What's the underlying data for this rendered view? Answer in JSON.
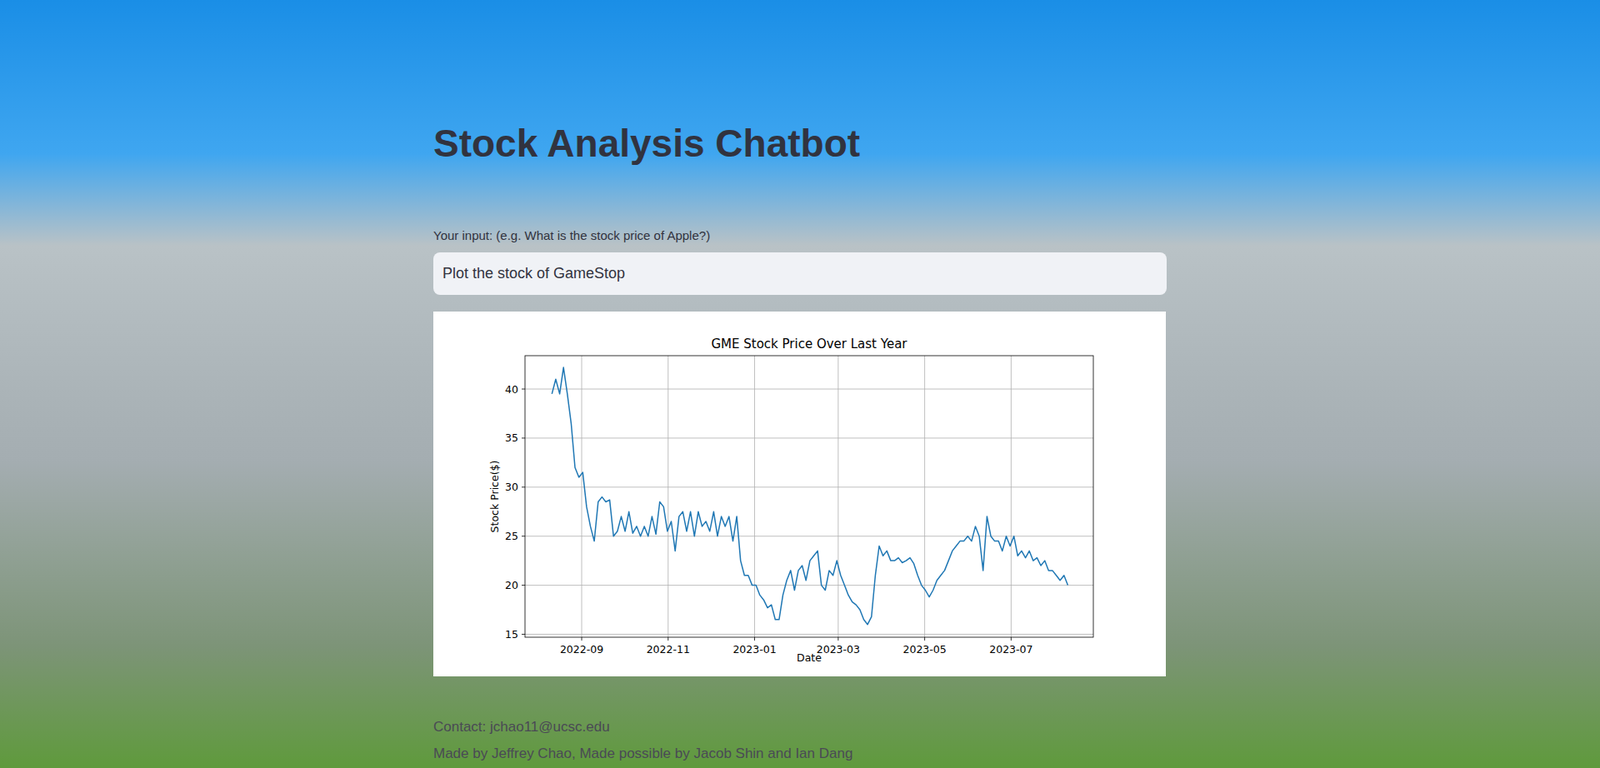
{
  "title": "Stock Analysis Chatbot",
  "input": {
    "label": "Your input: (e.g. What is the stock price of Apple?)",
    "value": "Plot the stock of GameStop"
  },
  "chart": {
    "title": "GME Stock Price Over Last Year",
    "y_label": "Stock Price($)",
    "x_label": "Date",
    "y_ticks": [
      "15",
      "20",
      "25",
      "30",
      "35",
      "40"
    ],
    "x_ticks": [
      "2022-09",
      "2022-11",
      "2023-01",
      "2023-03",
      "2023-05",
      "2023-07"
    ],
    "series": [
      {
        "values": [
          39.5,
          41,
          39.5,
          42.2,
          39.5,
          36.5,
          32,
          31,
          31.5,
          28,
          26,
          24.5,
          28.5,
          29,
          28.5,
          28.7,
          25,
          25.5,
          27,
          25.5,
          27.5,
          25.3,
          26,
          25,
          26,
          25,
          27,
          25.2,
          28.5,
          28,
          25.5,
          26.5,
          23.5,
          27,
          27.5,
          25.5,
          27.5,
          25,
          27.5,
          26,
          26.5,
          25.5,
          27.5,
          25,
          27,
          26,
          27,
          24.5,
          27,
          22.5,
          21,
          21,
          20,
          20,
          19,
          18.5,
          17.7,
          18,
          16.5,
          16.5,
          19,
          20.5,
          21.5,
          19.5,
          21.5,
          22,
          20.5,
          22.5,
          23,
          23.5,
          20,
          19.5,
          21.5,
          21,
          22.5,
          21,
          20,
          19,
          18.3,
          18,
          17.5,
          16.5,
          16,
          16.8,
          21,
          24,
          23,
          23.5,
          22.5,
          22.5,
          22.8,
          22.3,
          22.5,
          22.8,
          22.2,
          21,
          20,
          19.5,
          18.8,
          19.5,
          20.5,
          21,
          21.5,
          22.5,
          23.5,
          24,
          24.5,
          24.5,
          25,
          24.5,
          26,
          25,
          21.5,
          27,
          25,
          24.5,
          24.5,
          23.5,
          25,
          24,
          25,
          23,
          23.5,
          22.8,
          23.5,
          22.5,
          22.8,
          22,
          22.5,
          21.5,
          21.5,
          21,
          20.5,
          21,
          20
        ]
      }
    ]
  },
  "footer": {
    "contact": "Contact: jchao11@ucsc.edu",
    "credits": "Made by Jeffrey Chao, Made possible by Jacob Shin and Ian Dang"
  }
}
